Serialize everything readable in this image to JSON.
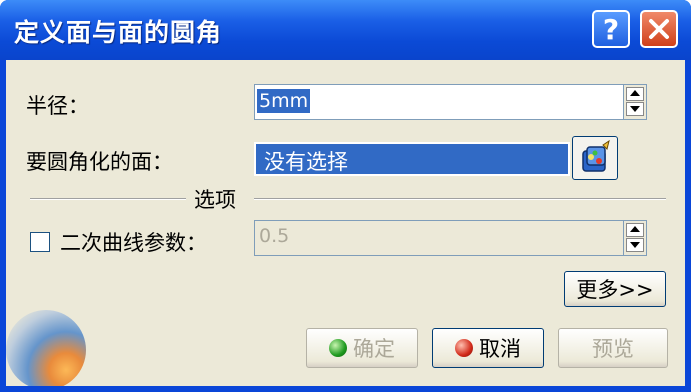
{
  "window": {
    "title": "定义面与面的圆角",
    "help_label": "?"
  },
  "radius": {
    "label": "半径：",
    "value": "5mm"
  },
  "faces": {
    "label": "要圆角化的面：",
    "value": "没有选择"
  },
  "options": {
    "section_label": "选项",
    "conic_label": "二次曲线参数：",
    "conic_checked": false,
    "conic_value": "0.5"
  },
  "buttons": {
    "more": "更多>>",
    "ok": "确定",
    "cancel": "取消",
    "preview": "预览"
  },
  "colors": {
    "titlebar": "#0a46d8",
    "panel": "#ece9d8",
    "selection": "#316ac5"
  }
}
